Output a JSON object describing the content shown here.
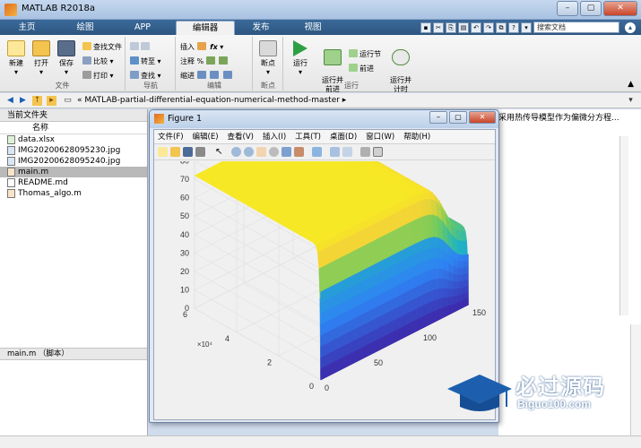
{
  "window": {
    "title": "MATLAB R2018a"
  },
  "tabs": [
    {
      "label": "主页"
    },
    {
      "label": "绘图"
    },
    {
      "label": "APP"
    },
    {
      "label": "编辑器"
    },
    {
      "label": "发布"
    },
    {
      "label": "视图"
    }
  ],
  "search": {
    "placeholder": "搜索文档"
  },
  "toolstrip": {
    "file": {
      "label": "文件",
      "new": "新建",
      "open": "打开",
      "save": "保存",
      "find_files": "查找文件",
      "compare": "比较",
      "print": "打印"
    },
    "navigate": {
      "label": "导航",
      "goto": "转至",
      "find": "查找"
    },
    "edit": {
      "label": "编辑",
      "insert": "插入",
      "comment": "注释",
      "indent": "缩进",
      "fx": "fx"
    },
    "breakpoints": {
      "label": "断点",
      "breakpoint": "断点"
    },
    "run": {
      "label": "运行",
      "run": "运行",
      "run_advance": "运行并\n前进",
      "run_section": "运行节",
      "advance": "前进",
      "run_time": "运行并\n计时"
    }
  },
  "address": {
    "path": "MATLAB-partial-differential-equation-numerical-method-master"
  },
  "current_folder": {
    "title": "当前文件夹",
    "column": "名称",
    "files": [
      {
        "name": "data.xlsx",
        "selected": false
      },
      {
        "name": "IMG20200628095230.jpg",
        "selected": false
      },
      {
        "name": "IMG20200628095240.jpg",
        "selected": false
      },
      {
        "name": "main.m",
        "selected": true
      },
      {
        "name": "README.md",
        "selected": false
      },
      {
        "name": "Thomas_algo.m",
        "selected": false
      }
    ],
    "details": "main.m （脚本）"
  },
  "editor": {
    "snippet": "采用热传导模型作为偏微分方程..."
  },
  "figure": {
    "title": "Figure 1",
    "menus": [
      "文件(F)",
      "编辑(E)",
      "查看(V)",
      "插入(I)",
      "工具(T)",
      "桌面(D)",
      "窗口(W)",
      "帮助(H)"
    ]
  },
  "chart_data": {
    "type": "surface",
    "zlim": [
      0,
      80
    ],
    "zticks": [
      "0",
      "10",
      "20",
      "30",
      "40",
      "50",
      "60",
      "70",
      "80"
    ],
    "xticks": [
      "0",
      "50",
      "100",
      "150"
    ],
    "yticks": [
      "0",
      "2",
      "4",
      "6"
    ],
    "y_multiplier": "×10⁴",
    "plateau_value": 72,
    "edge_value": 40,
    "drop_value": 0,
    "colormap": [
      "#3e26a8",
      "#2f83f4",
      "#1fb4c0",
      "#71cb5d",
      "#f5d534",
      "#f9fb15"
    ]
  },
  "watermark": {
    "text": "必过源码",
    "sub": "Biguo100.com"
  }
}
